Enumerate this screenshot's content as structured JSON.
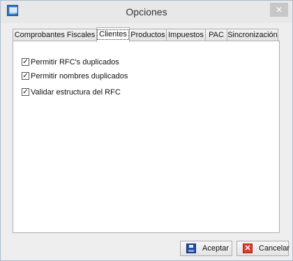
{
  "window": {
    "title": "Opciones",
    "close_symbol": "✕"
  },
  "tabs": [
    {
      "label": "Comprobantes Fiscales",
      "active": false
    },
    {
      "label": "Clientes",
      "active": true
    },
    {
      "label": "Productos",
      "active": false
    },
    {
      "label": "Impuestos",
      "active": false
    },
    {
      "label": "PAC",
      "active": false
    },
    {
      "label": "Sincronización",
      "active": false
    }
  ],
  "clientes": {
    "options": [
      {
        "label": "Permitir RFC's duplicados",
        "checked": true
      },
      {
        "label": "Permitir nombres duplicados",
        "checked": true
      },
      {
        "label": "Validar estructura del RFC",
        "checked": true
      }
    ]
  },
  "buttons": {
    "accept_label": "Aceptar",
    "cancel_label": "Cancelar"
  },
  "icons": {
    "app": "app-icon",
    "close": "close-icon",
    "accept": "save-icon",
    "cancel": "cancel-icon"
  },
  "colors": {
    "window_bg": "#eeeeee",
    "titlebar_bg": "#e8e8e8",
    "border": "#adadad",
    "cancel_red": "#e03a2d",
    "save_blue": "#1e4fa6"
  }
}
